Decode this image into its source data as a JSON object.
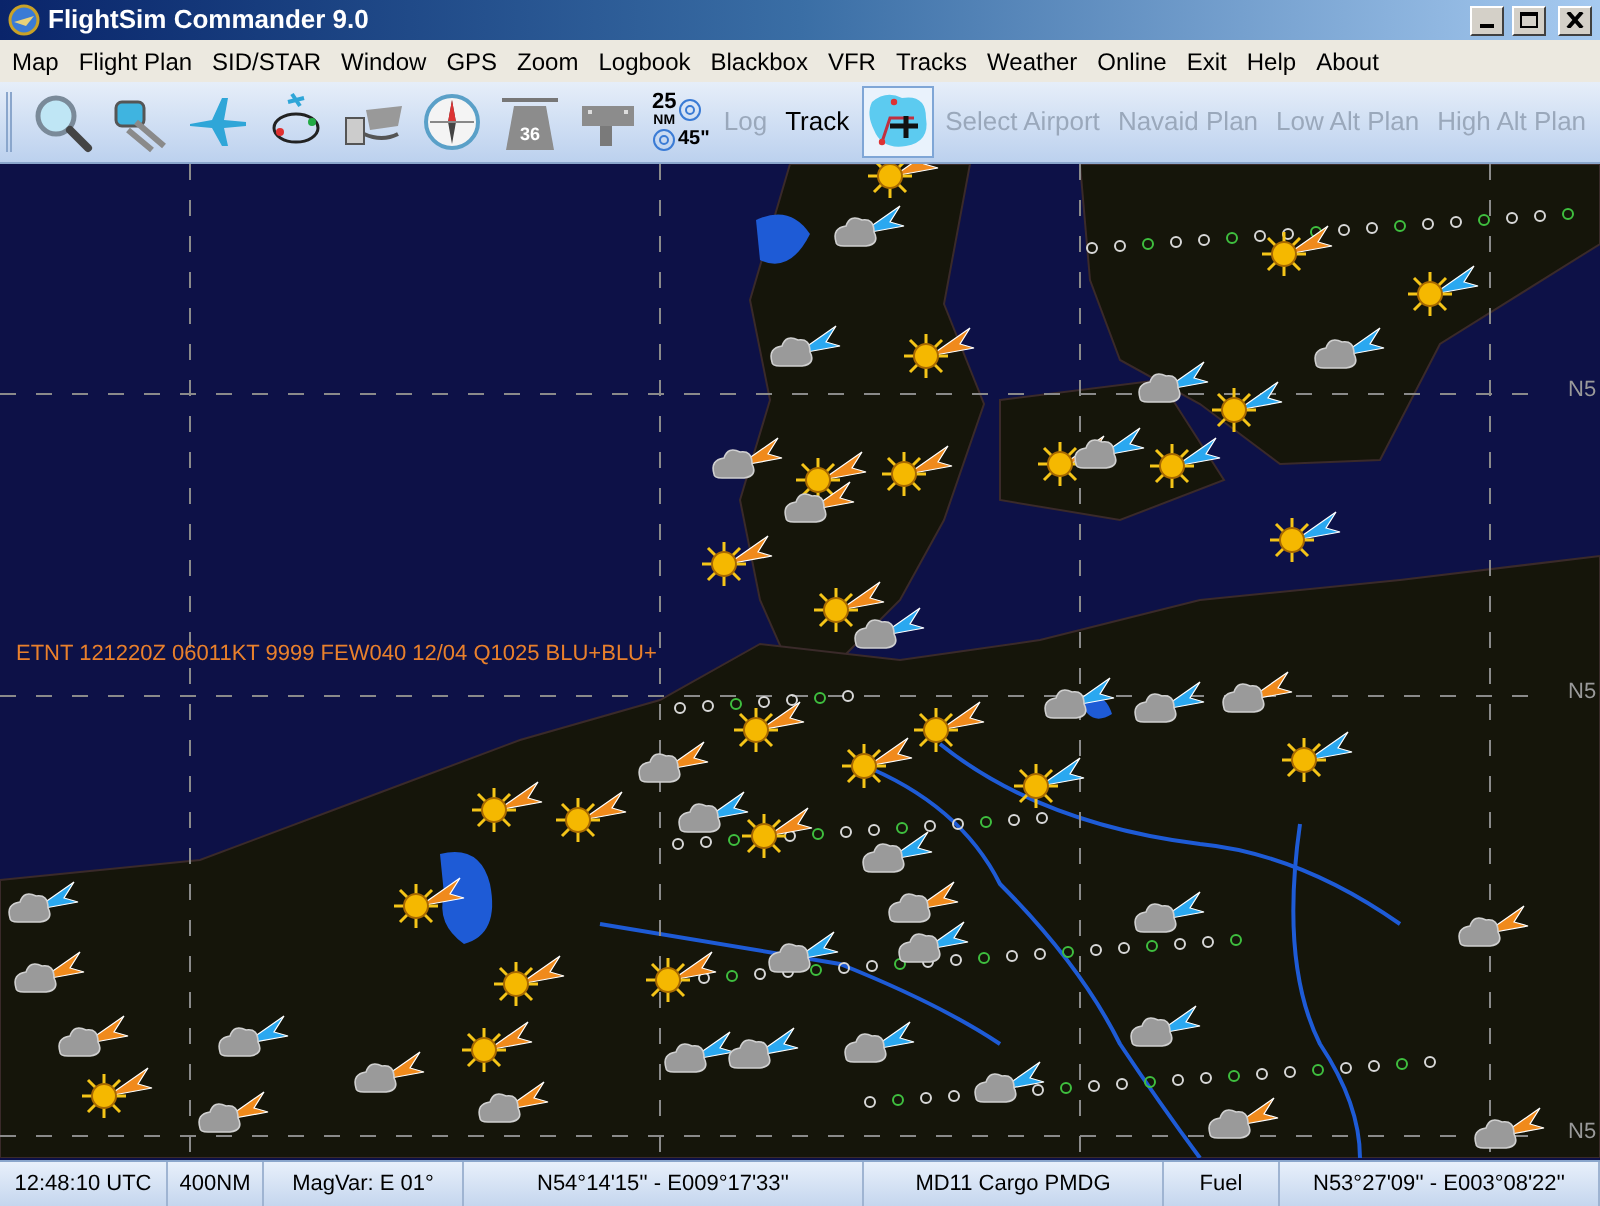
{
  "window": {
    "title": "FlightSim Commander 9.0"
  },
  "menu": [
    "Map",
    "Flight Plan",
    "SID/STAR",
    "Window",
    "GPS",
    "Zoom",
    "Logbook",
    "Blackbox",
    "VFR",
    "Tracks",
    "Weather",
    "Online",
    "Exit",
    "Help",
    "About"
  ],
  "toolbar": [
    {
      "kind": "magnifier",
      "selected": false
    },
    {
      "kind": "satellite",
      "selected": false
    },
    {
      "kind": "airplane",
      "selected": false
    },
    {
      "kind": "route",
      "selected": false
    },
    {
      "kind": "fuel",
      "selected": false
    },
    {
      "kind": "compass",
      "selected": false
    },
    {
      "kind": "runway",
      "selected": false,
      "label": "36"
    },
    {
      "kind": "gate",
      "selected": false
    },
    {
      "kind": "range",
      "distance": "25",
      "unit": "NM",
      "angle": "45\""
    },
    {
      "kind": "text",
      "label": "Log",
      "disabled": true
    },
    {
      "kind": "text",
      "label": "Track",
      "disabled": false
    },
    {
      "kind": "plan",
      "selected": true
    },
    {
      "kind": "text",
      "label": "Select Airport",
      "disabled": true
    },
    {
      "kind": "text",
      "label": "Navaid Plan",
      "disabled": true
    },
    {
      "kind": "text",
      "label": "Low Alt Plan",
      "disabled": true
    },
    {
      "kind": "text",
      "label": "High Alt Plan",
      "disabled": true
    }
  ],
  "map": {
    "metar": "ETNT 121220Z 06011KT 9999 FEW040 12/04 Q1025 BLU+BLU+",
    "grid_labels": [
      "N5",
      "N5",
      "N5"
    ]
  },
  "status_bar": [
    "12:48:10 UTC",
    "400NM",
    "MagVar: E 01°",
    "N54°14'15'' - E009°17'33''",
    "MD11 Cargo PMDG",
    "Fuel",
    "N53°27'09'' - E003°08'22''"
  ]
}
